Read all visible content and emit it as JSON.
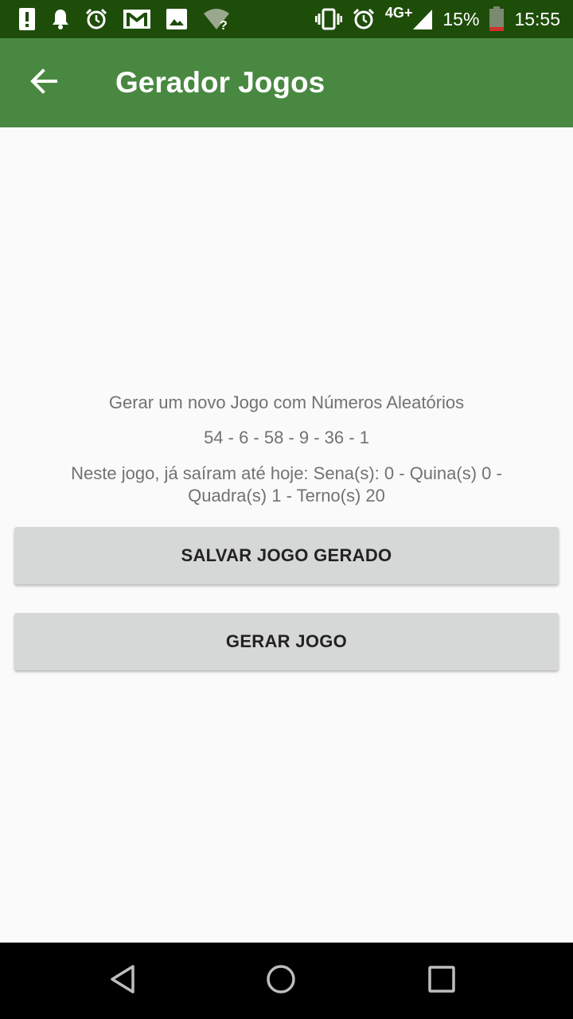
{
  "status_bar": {
    "network_type": "4G+",
    "battery_percent": "15%",
    "time": "15:55",
    "left_icons": [
      "alert-icon",
      "notification-bell-icon",
      "alarm-clock-icon",
      "gmail-icon",
      "image-icon",
      "wifi-unknown-icon"
    ],
    "right_icons": [
      "vibrate-icon",
      "alarm-clock-icon",
      "signal-icon",
      "battery-icon"
    ],
    "colors": {
      "background": "#1e4d0a",
      "battery_low": "#d32f2f"
    }
  },
  "app_bar": {
    "title": "Gerador Jogos",
    "back_icon": "arrow-back-icon",
    "color": "#498841"
  },
  "main": {
    "headline": "Gerar um novo Jogo com Números Aleatórios",
    "numbers": "54 - 6 - 58 - 9 - 36 - 1",
    "stats": "Neste jogo, já saíram até hoje: Sena(s): 0 - Quina(s) 0 - Quadra(s) 1 - Terno(s) 20",
    "save_button_label": "SALVAR JOGO GERADO",
    "generate_button_label": "GERAR JOGO"
  },
  "nav_bar": {
    "buttons": [
      "back-triangle-icon",
      "home-circle-icon",
      "recents-square-icon"
    ]
  }
}
